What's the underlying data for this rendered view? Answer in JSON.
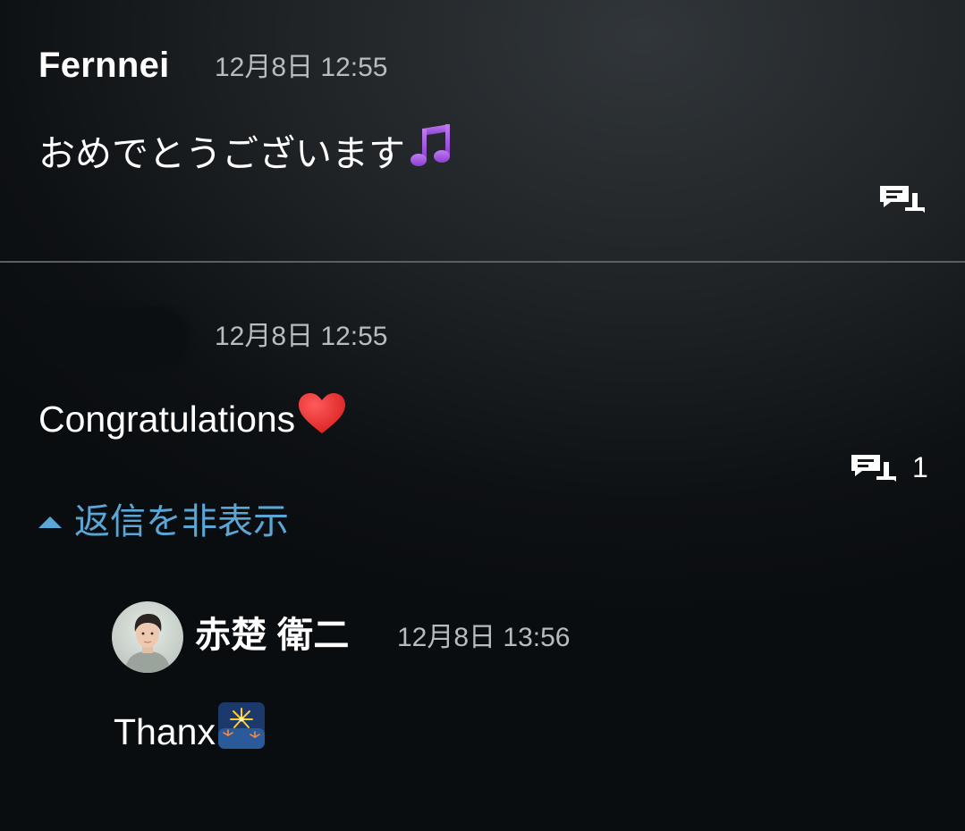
{
  "comments": [
    {
      "author": "Fernnei",
      "timestamp": "12月8日 12:55",
      "text": "おめでとうございます",
      "emoji": "musical-notes",
      "reply_count": ""
    },
    {
      "author": "",
      "timestamp": "12月8日 12:55",
      "text": "Congratulations",
      "emoji": "red-heart",
      "reply_count": "1",
      "toggle_label": "返信を非表示",
      "replies": [
        {
          "author": "赤楚 衛二",
          "timestamp": "12月8日 13:56",
          "text": "Thanx",
          "emoji": "fireworks"
        }
      ]
    }
  ],
  "colors": {
    "link_blue": "#5aa7d6",
    "timestamp_gray": "#b9bcbf",
    "divider": "#5a5f63"
  },
  "icons": {
    "reply": "reply-bubbles-icon",
    "toggle": "caret-up-icon"
  }
}
